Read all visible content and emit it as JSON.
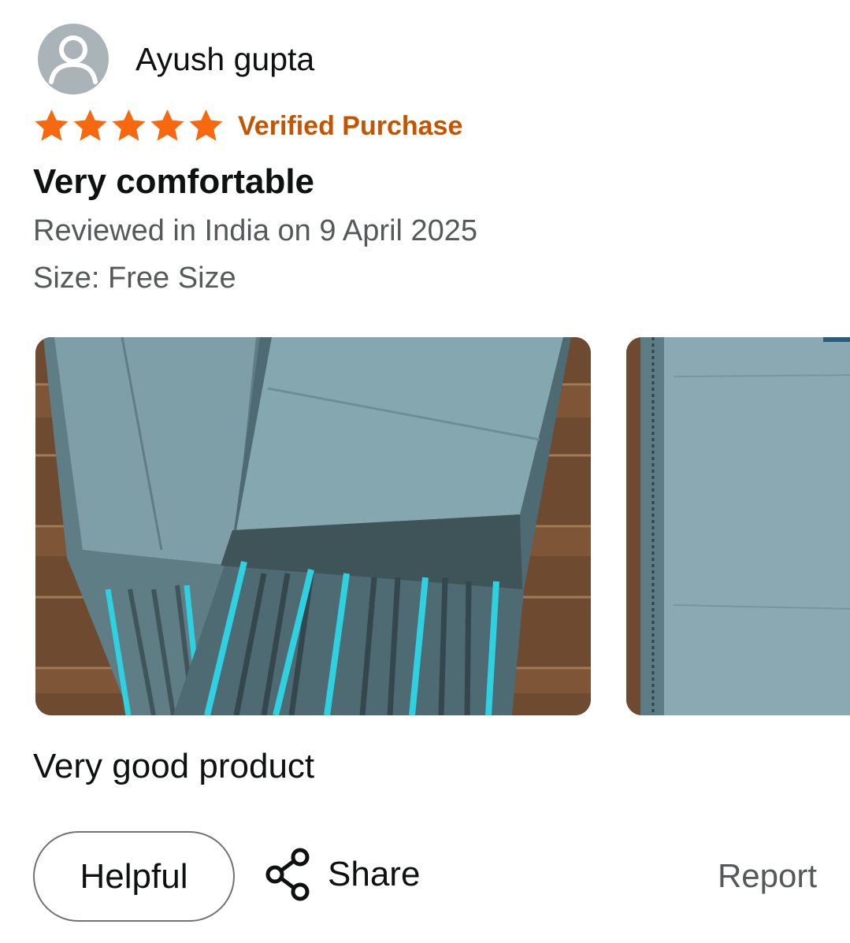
{
  "reviewer": {
    "name": "Ayush gupta",
    "avatar_icon": "user-silhouette-icon"
  },
  "rating": {
    "value": 5,
    "max": 5,
    "star_color": "#f7680f"
  },
  "verified": {
    "label": "Verified Purchase",
    "color": "#c45500"
  },
  "review": {
    "title": "Very comfortable",
    "date": "Reviewed in India on 9 April 2025",
    "variant": "Size: Free Size",
    "body": "Very good product"
  },
  "photos": {
    "count_visible": 2
  },
  "actions": {
    "helpful_label": "Helpful",
    "share_label": "Share",
    "share_icon": "share-icon",
    "report_label": "Report"
  }
}
